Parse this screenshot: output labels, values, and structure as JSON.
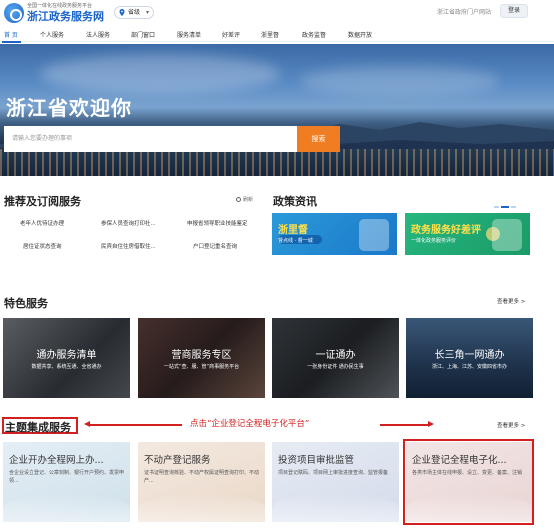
{
  "header": {
    "logo_sub": "全国一体化在线政务服务平台",
    "logo_title": "浙江政务服务网",
    "region": "省级",
    "portal_link": "浙江省政府门户网站",
    "login": "登录"
  },
  "nav": {
    "items": [
      "首 页",
      "个人服务",
      "法人服务",
      "部门窗口",
      "服务清单",
      "好差评",
      "浙里督",
      "政务监督",
      "数据开放"
    ]
  },
  "hero": {
    "title": "浙江省欢迎你",
    "search_placeholder": "请输入您要办理的事项",
    "search_button": "搜索"
  },
  "recommend": {
    "title": "推荐及订阅服务",
    "refresh": "刷新",
    "links": [
      "老年人优待证办理",
      "参保人员查询打印社...",
      "申报省领导职业技能鉴定",
      "居住证状态查询",
      "民宾自住住房借取住...",
      "户口登记重名查询"
    ]
  },
  "news": {
    "title": "政策资讯",
    "card1_big": "浙里督",
    "card1_small": "督点线 · 督一城",
    "card2_big": "政务服务好差评",
    "card2_small": "一体化政务服务评价"
  },
  "featured": {
    "title": "特色服务",
    "more": "查看更多 >",
    "cards": [
      {
        "title": "通办服务清单",
        "sub": "数据共享、系统互通、全省通办"
      },
      {
        "title": "营商服务专区",
        "sub": "一站式“查、服、管”商事服务平台"
      },
      {
        "title": "一证通办",
        "sub": "一张身份证件 通办民生事"
      },
      {
        "title": "长三角一网通办",
        "sub": "浙江、上海、江苏、安徽四省市办"
      }
    ]
  },
  "topics": {
    "title": "主题集成服务",
    "more": "查看更多 >",
    "annotation": "点击“企业登记全程电子化平台”",
    "cards": [
      {
        "title": "企业开办全程网上办...",
        "desc": "含企业设立登记、公章刻制、银行开户预约、发票申领..."
      },
      {
        "title": "不动产登记服务",
        "desc": "证书证明查询核验、不动产权属证明查询打印、不动产..."
      },
      {
        "title": "投资项目审批监管",
        "desc": "项目登记赋码、项目网上审批进度查询、监管报备"
      },
      {
        "title": "企业登记全程电子化...",
        "desc": "各类市场主体在线申报、设立、变更、备案、注销"
      }
    ]
  },
  "colors": {
    "brand_blue": "#1a63c9",
    "search_orange": "#f07d22",
    "annotation_red": "#d21f1f"
  }
}
